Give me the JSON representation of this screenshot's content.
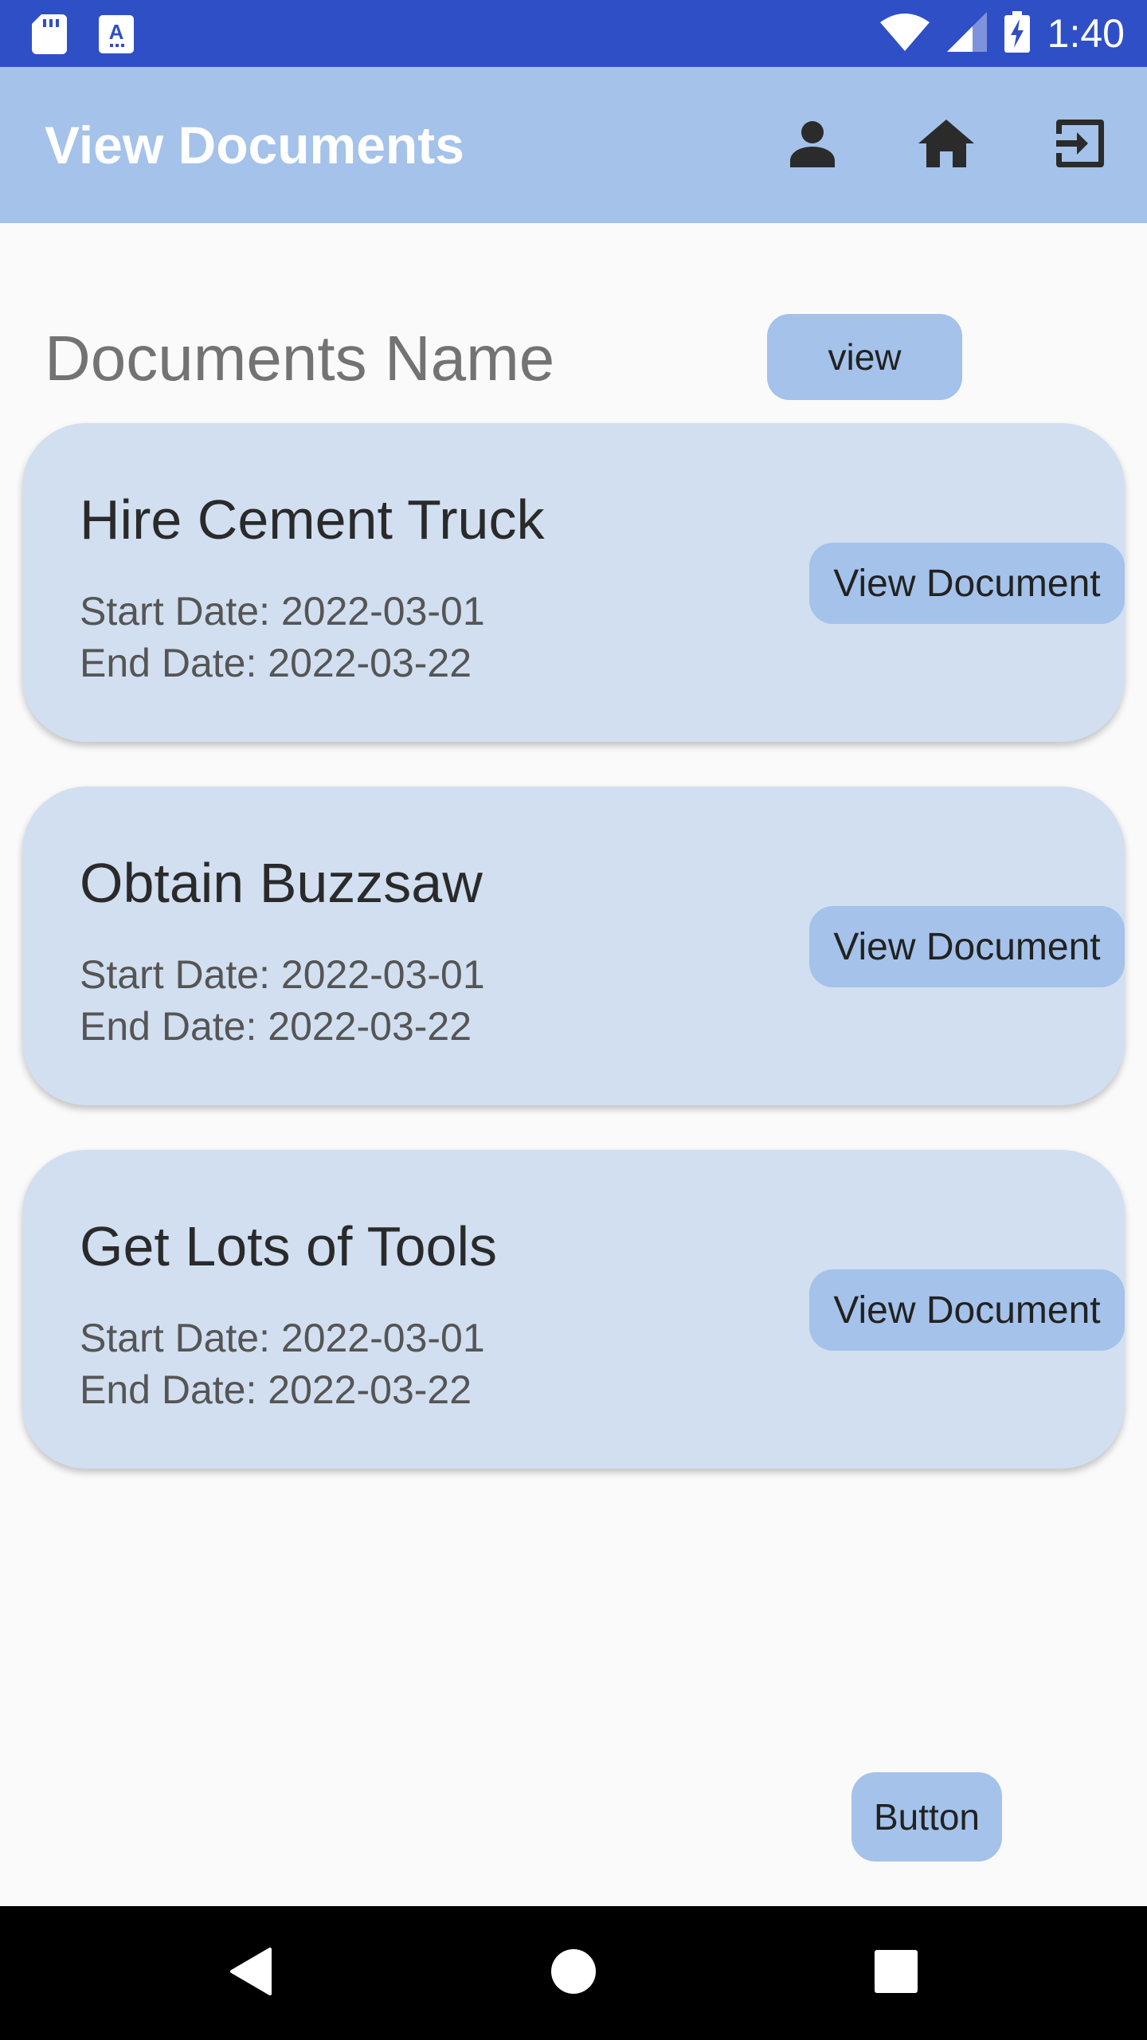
{
  "status_bar": {
    "time": "1:40",
    "left_icons": [
      "sd-card-icon",
      "keyboard-a-icon"
    ],
    "right_icons": [
      "wifi-icon",
      "signal-icon",
      "battery-charging-icon"
    ],
    "background": "#2f4fc6"
  },
  "app_bar": {
    "title": "View Documents",
    "actions": [
      "person-icon",
      "home-icon",
      "logout-icon"
    ],
    "background": "#a4c2ea"
  },
  "main": {
    "heading": "Documents Name",
    "view_button_label": "view",
    "documents": [
      {
        "title": "Hire Cement Truck",
        "start": "Start Date: 2022-03-01",
        "end": "End Date: 2022-03-22",
        "button_label": "View Document"
      },
      {
        "title": "Obtain Buzzsaw",
        "start": "Start Date: 2022-03-01",
        "end": "End Date: 2022-03-22",
        "button_label": "View Document"
      },
      {
        "title": "Get Lots of Tools",
        "start": "Start Date: 2022-03-01",
        "end": "End Date: 2022-03-22",
        "button_label": "View Document"
      }
    ],
    "bottom_button_label": "Button",
    "card_color": "#d1dff0",
    "button_color": "#a4c2ea"
  },
  "nav_bar": {
    "buttons": [
      "back-icon",
      "home-circle-icon",
      "recents-icon"
    ]
  }
}
